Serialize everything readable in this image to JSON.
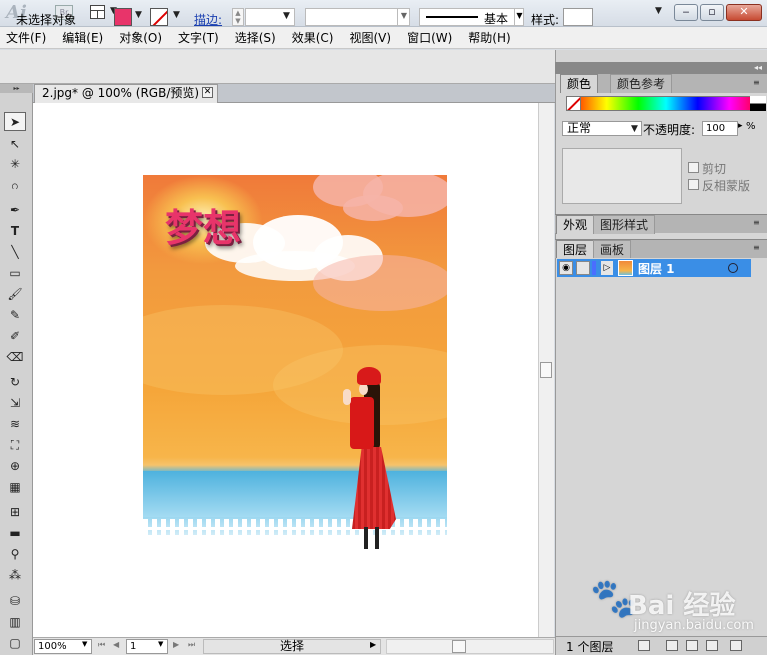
{
  "app": {
    "logo": "Ai",
    "bridge_badge": "Br"
  },
  "menu": [
    "文件(F)",
    "编辑(E)",
    "对象(O)",
    "文字(T)",
    "选择(S)",
    "效果(C)",
    "视图(V)",
    "窗口(W)",
    "帮助(H)"
  ],
  "control": {
    "selection_label": "未选择对象",
    "fill_color": "#e8346a",
    "stroke_label": "描边:",
    "brush_name": "基本",
    "style_label": "样式:"
  },
  "document": {
    "tab_title": "2.jpg* @ 100% (RGB/预览)",
    "artwork_title": "梦想"
  },
  "status": {
    "zoom": "100%",
    "page": "1",
    "tool": "选择"
  },
  "panels": {
    "color": {
      "tab_active": "颜色",
      "tab_other": "颜色参考"
    },
    "transparency": {
      "blend_mode": "正常",
      "opacity_label": "不透明度:",
      "opacity_value": "100",
      "opacity_unit": "%",
      "clip_label": "剪切",
      "invert_label": "反相蒙版"
    },
    "appearance": {
      "tab_active": "外观",
      "tab_other": "图形样式"
    },
    "layers": {
      "tab_active": "图层",
      "tab_other": "画板",
      "layer_name": "图层 1",
      "count": "1 个图层"
    }
  },
  "watermark": {
    "text": "Bai 经验",
    "url": "jingyan.baidu.com"
  },
  "colors": {
    "accent_blue": "#3a8ee6",
    "fill": "#e8346a"
  }
}
